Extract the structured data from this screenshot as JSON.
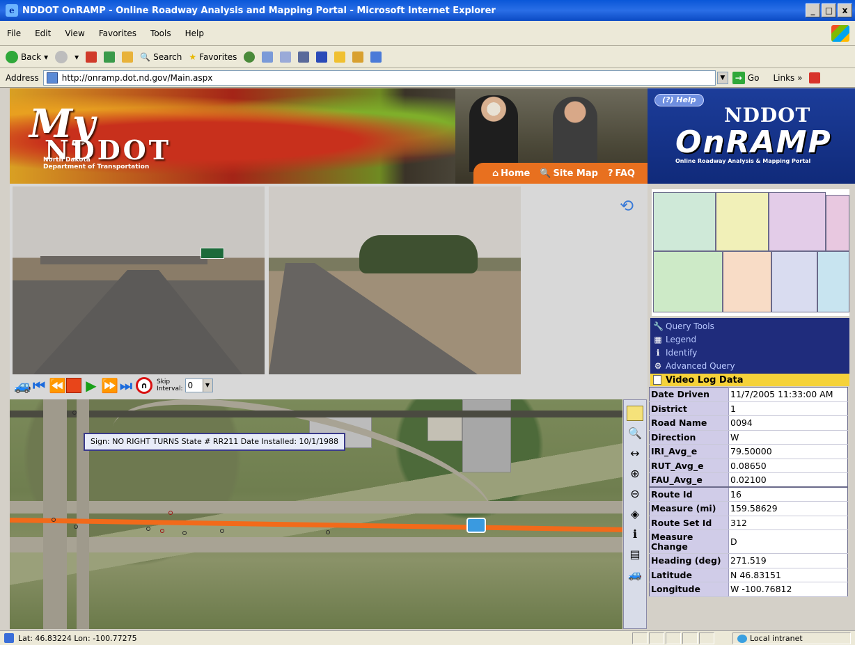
{
  "window": {
    "title": "NDDOT OnRAMP - Online Roadway Analysis and Mapping Portal - Microsoft Internet Explorer",
    "buttons": [
      "_",
      "□",
      "x"
    ]
  },
  "menu": [
    "File",
    "Edit",
    "View",
    "Favorites",
    "Tools",
    "Help"
  ],
  "toolbar": {
    "back": "Back",
    "search": "Search",
    "favorites": "Favorites"
  },
  "address": {
    "label": "Address",
    "url": "http://onramp.dot.nd.gov/Main.aspx",
    "go": "Go",
    "links": "Links »"
  },
  "banner": {
    "my": "My",
    "nd": "NDDOT",
    "sub1": "North Dakota",
    "sub2": "Department of Transportation",
    "nav": {
      "home": "Home",
      "sitemap": "Site Map",
      "faq": "FAQ"
    },
    "help": "Help",
    "ndot": "NDDOT",
    "onramp": "OnRAMP",
    "onramp_sub": "Online Roadway Analysis & Mapping Portal"
  },
  "controls": {
    "skip_label_1": "Skip",
    "skip_label_2": "Interval:",
    "skip_value": "0"
  },
  "map": {
    "tooltip": "Sign: NO RIGHT TURNS State # RR211 Date Installed: 10/1/1988"
  },
  "panel": {
    "items": [
      "Query Tools",
      "Legend",
      "Identify",
      "Advanced Query"
    ],
    "video_log_title": "Video Log Data"
  },
  "video_log": [
    {
      "key": "Date Driven",
      "value": "11/7/2005 11:33:00 AM"
    },
    {
      "key": "District",
      "value": "1"
    },
    {
      "key": "Road Name",
      "value": "0094"
    },
    {
      "key": "Direction",
      "value": "W"
    },
    {
      "key": "IRI_Avg_e",
      "value": "79.50000"
    },
    {
      "key": "RUT_Avg_e",
      "value": "0.08650"
    },
    {
      "key": "FAU_Avg_e",
      "value": "0.02100"
    },
    {
      "key": "Route Id",
      "value": "16"
    },
    {
      "key": "Measure (mi)",
      "value": "159.58629"
    },
    {
      "key": "Route Set Id",
      "value": "312"
    },
    {
      "key": "Measure Change",
      "value": "D"
    },
    {
      "key": "Heading (deg)",
      "value": "271.519"
    },
    {
      "key": "Latitude",
      "value": "N 46.83151"
    },
    {
      "key": "Longitude",
      "value": "W -100.76812"
    }
  ],
  "status": {
    "coords": "Lat: 46.83224 Lon: -100.77275",
    "zone": "Local intranet"
  },
  "colors": {
    "route": "#f26a1a",
    "panel_bg": "#1f2c7c",
    "header_yellow": "#f5d23a",
    "nav_orange": "#e8701f"
  }
}
